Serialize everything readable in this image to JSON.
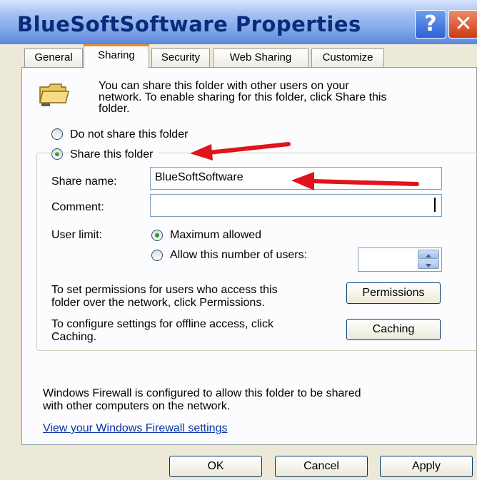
{
  "window": {
    "title": "BlueSoftSoftware Properties",
    "help_glyph": "?",
    "close_glyph": "✕"
  },
  "tabs": [
    {
      "label": "General"
    },
    {
      "label": "Sharing"
    },
    {
      "label": "Security"
    },
    {
      "label": "Web Sharing"
    },
    {
      "label": "Customize"
    }
  ],
  "sharing": {
    "info_line1": "You can share this folder with other users on your",
    "info_line2": "network.  To enable sharing for this folder, click Share this",
    "info_line3": "folder.",
    "radio_not_share": "Do not share this folder",
    "radio_share": "Share this folder",
    "share_name_label": "Share name:",
    "share_name_value": "BlueSoftSoftware",
    "comment_label": "Comment:",
    "comment_value": "",
    "user_limit_label": "User limit:",
    "radio_max": "Maximum allowed",
    "radio_allow_number": "Allow this number of users:",
    "permissions_line1": "To set permissions for users who access this",
    "permissions_line2": "folder over the network, click Permissions.",
    "permissions_button": "Permissions",
    "caching_line1": "To configure settings for offline access, click",
    "caching_line2": "Caching.",
    "caching_button": "Caching",
    "firewall_line1": "Windows Firewall is configured to allow this folder to be shared",
    "firewall_line2": "with other computers on the network.",
    "firewall_link": "View your Windows Firewall settings"
  },
  "buttons": {
    "ok": "OK",
    "cancel": "Cancel",
    "apply": "Apply"
  },
  "colors": {
    "titlebar_text": "#0a2a7a",
    "tab_highlight": "#e68b2c",
    "annotation_arrow": "#e0141a",
    "link": "#0b34a6"
  }
}
